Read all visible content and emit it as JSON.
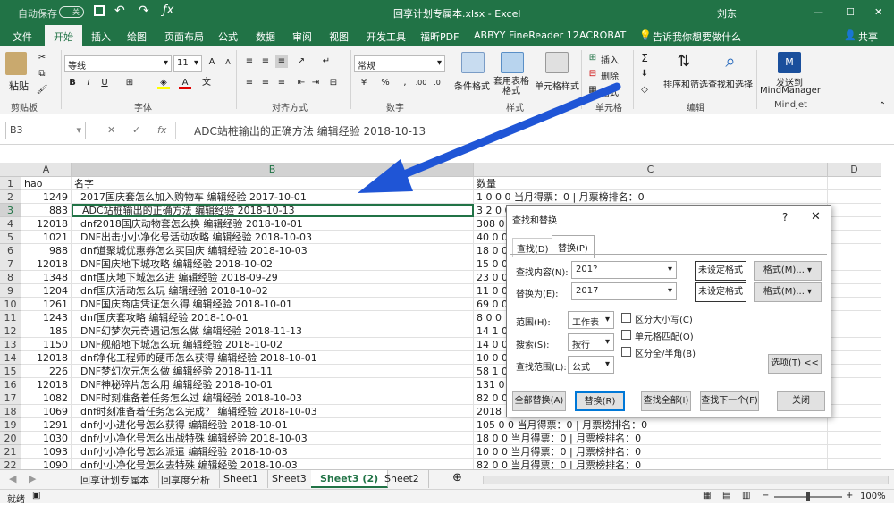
{
  "titlebar": {
    "autosave": "自动保存",
    "autosave_state": "关",
    "title": "回享计划专属本.xlsx  -  Excel",
    "user": "刘东"
  },
  "tabs": [
    "文件",
    "开始",
    "插入",
    "绘图",
    "页面布局",
    "公式",
    "数据",
    "审阅",
    "视图",
    "开发工具",
    "福昕PDF",
    "ABBYY FineReader 12",
    "ACROBAT"
  ],
  "tellme": "告诉我你想要做什么",
  "share": "共享",
  "ribbon": {
    "paste": "粘贴",
    "clipboard": "剪贴板",
    "font_name": "等线",
    "font_size": "11",
    "font_group": "字体",
    "align_group": "对齐方式",
    "numfmt": "常规",
    "number_group": "数字",
    "cond": "条件格式",
    "table": "套用表格格式",
    "cellstyle": "单元格样式",
    "styles_group": "样式",
    "insert": "插入",
    "delete": "删除",
    "format": "格式",
    "cells_group": "单元格",
    "sortfilter": "排序和筛选",
    "findselect": "查找和选择",
    "edit_group": "编辑",
    "send": "发送到",
    "mindmanager": "MindManager",
    "mindjet": "Mindjet"
  },
  "formula": {
    "namebox": "B3",
    "value": "ADC站桩输出的正确方法 编辑经验 2018-10-13"
  },
  "columns": [
    "A",
    "B",
    "C",
    "D"
  ],
  "rows": [
    {
      "n": "1",
      "a": "hao",
      "b": "名字",
      "c": "数量"
    },
    {
      "n": "2",
      "a": "1249",
      "b": "2017国庆套怎么加入购物车 编辑经验 2017-10-01",
      "c": "1 0 0 0 当月得票：0 | 月票榜排名：0"
    },
    {
      "n": "3",
      "a": "883",
      "b": "ADC站桩输出的正确方法 编辑经验 2018-10-13",
      "c": "3 2 0 0 当月得票：0 | 月票榜排名：0"
    },
    {
      "n": "4",
      "a": "12018",
      "b": "dnf2018国庆动物套怎么换 编辑经验 2018-10-01",
      "c": "308 0"
    },
    {
      "n": "5",
      "a": "1021",
      "b": "DNF出击小小净化号活动攻略 编辑经验 2018-10-03",
      "c": "40 0 0"
    },
    {
      "n": "6",
      "a": "988",
      "b": "dnf道聚城优惠券怎么买国庆 编辑经验 2018-10-03",
      "c": "18 0 0"
    },
    {
      "n": "7",
      "a": "12018",
      "b": "DNF国庆地下城攻略 编辑经验 2018-10-02",
      "c": "15 0 0"
    },
    {
      "n": "8",
      "a": "1348",
      "b": "dnf国庆地下城怎么进 编辑经验 2018-09-29",
      "c": "23 0 0"
    },
    {
      "n": "9",
      "a": "1204",
      "b": "dnf国庆活动怎么玩 编辑经验 2018-10-02",
      "c": "11 0 0"
    },
    {
      "n": "10",
      "a": "1261",
      "b": "DNF国庆商店凭证怎么得 编辑经验 2018-10-01",
      "c": "69 0 0"
    },
    {
      "n": "11",
      "a": "1243",
      "b": "dnf国庆套攻略 编辑经验 2018-10-01",
      "c": "8 0 0"
    },
    {
      "n": "12",
      "a": "185",
      "b": "DNF幻梦次元奇遇记怎么做 编辑经验 2018-11-13",
      "c": "14 1 0"
    },
    {
      "n": "13",
      "a": "1150",
      "b": "DNF舰船地下城怎么玩 编辑经验 2018-10-02",
      "c": "14 0 0"
    },
    {
      "n": "14",
      "a": "12018",
      "b": "dnf净化工程师的硬币怎么获得 编辑经验 2018-10-01",
      "c": "10 0 0"
    },
    {
      "n": "15",
      "a": "226",
      "b": "DNF梦幻次元怎么做 编辑经验 2018-11-11",
      "c": "58 1 0"
    },
    {
      "n": "16",
      "a": "12018",
      "b": "DNF神秘碎片怎么用 编辑经验 2018-10-01",
      "c": "131 0"
    },
    {
      "n": "17",
      "a": "1082",
      "b": "DNF时刻准备着任务怎么过 编辑经验 2018-10-03",
      "c": "82 0 0"
    },
    {
      "n": "18",
      "a": "1069",
      "b": "dnf时刻准备着任务怎么完成？ 编辑经验 2018-10-03",
      "c": "2018"
    },
    {
      "n": "19",
      "a": "1291",
      "b": "dnf小小进化号怎么获得 编辑经验 2018-10-01",
      "c": "105 0 0 当月得票：0 | 月票榜排名：0"
    },
    {
      "n": "20",
      "a": "1030",
      "b": "dnf小小净化号怎么出战特殊 编辑经验 2018-10-03",
      "c": "18 0 0 当月得票：0 | 月票榜排名：0"
    },
    {
      "n": "21",
      "a": "1093",
      "b": "dnf小小净化号怎么派遣 编辑经验 2018-10-03",
      "c": "10 0 0 当月得票：0 | 月票榜排名：0"
    },
    {
      "n": "22",
      "a": "1090",
      "b": "dnf小小净化号怎么去特殊 编辑经验 2018-10-03",
      "c": "82 0 0 当月得票：0 | 月票榜排名：0"
    }
  ],
  "sheets": [
    "回享计划专属本",
    "回享度分析",
    "Sheet1",
    "Sheet3",
    "Sheet3 (2)",
    "Sheet2"
  ],
  "status": {
    "ready": "就绪",
    "zoom": "100%"
  },
  "dialog": {
    "title": "查找和替换",
    "help": "?",
    "tab_find": "查找(D)",
    "tab_replace": "替换(P)",
    "find_label": "查找内容(N):",
    "find_value": "201?",
    "replace_label": "替换为(E):",
    "replace_value": "2017",
    "no_format": "未设定格式",
    "format_btn": "格式(M)...",
    "within_label": "范围(H):",
    "within_value": "工作表",
    "search_label": "搜索(S):",
    "search_value": "按行",
    "lookin_label": "查找范围(L):",
    "lookin_value": "公式",
    "match_case": "区分大小写(C)",
    "match_cell": "单元格匹配(O)",
    "match_width": "区分全/半角(B)",
    "options": "选项(T) <<",
    "replace_all": "全部替换(A)",
    "replace": "替换(R)",
    "find_all": "查找全部(I)",
    "find_next": "查找下一个(F)",
    "close": "关闭"
  },
  "colors": {
    "excel_green": "#217346",
    "arrow": "#1f55d6"
  }
}
